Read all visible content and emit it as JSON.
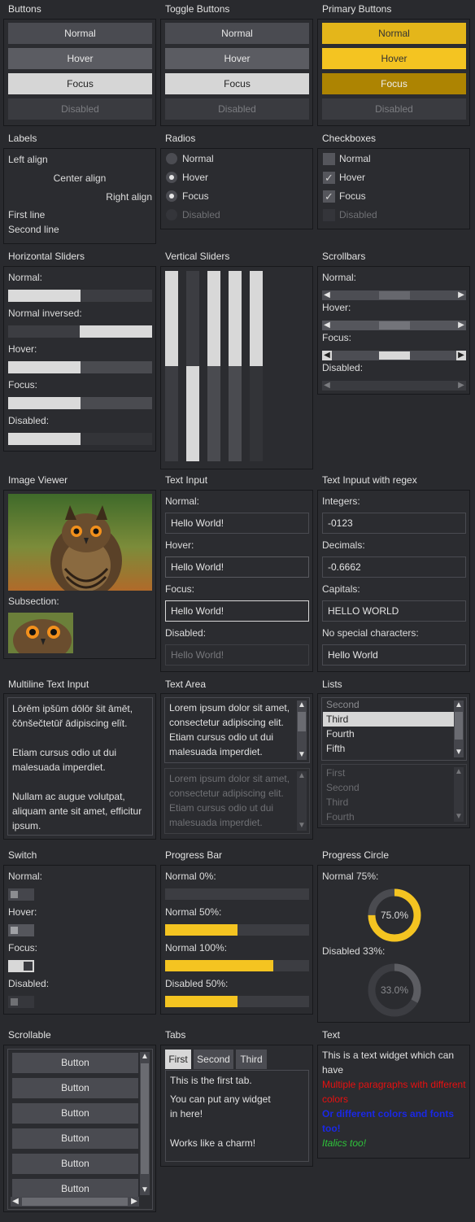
{
  "buttons": {
    "title": "Buttons",
    "normal": "Normal",
    "hover": "Hover",
    "focus": "Focus",
    "disabled": "Disabled"
  },
  "toggle_buttons": {
    "title": "Toggle Buttons",
    "normal": "Normal",
    "hover": "Hover",
    "focus": "Focus",
    "disabled": "Disabled"
  },
  "primary_buttons": {
    "title": "Primary Buttons",
    "normal": "Normal",
    "hover": "Hover",
    "focus": "Focus",
    "disabled": "Disabled"
  },
  "labels": {
    "title": "Labels",
    "left": "Left align",
    "center": "Center align",
    "right": "Right align",
    "line1": "First line",
    "line2": "Second line"
  },
  "radios": {
    "title": "Radios",
    "normal": "Normal",
    "hover": "Hover",
    "focus": "Focus",
    "disabled": "Disabled"
  },
  "checkboxes": {
    "title": "Checkboxes",
    "normal": "Normal",
    "hover": "Hover",
    "focus": "Focus",
    "disabled": "Disabled"
  },
  "hsliders": {
    "title": "Horizontal Sliders",
    "normal": "Normal:",
    "inversed": "Normal inversed:",
    "hover": "Hover:",
    "focus": "Focus:",
    "disabled": "Disabled:",
    "value": 0.5
  },
  "vsliders": {
    "title": "Vertical Sliders",
    "values": [
      0.5,
      0.5,
      0.5,
      0.5,
      0.5
    ]
  },
  "scrollbars": {
    "title": "Scrollbars",
    "normal": "Normal:",
    "hover": "Hover:",
    "focus": "Focus:",
    "disabled": "Disabled:",
    "left_arrow": "◀",
    "right_arrow": "▶"
  },
  "image_viewer": {
    "title": "Image Viewer",
    "subsection": "Subsection:"
  },
  "text_input": {
    "title": "Text Input",
    "normal": "Normal:",
    "hover": "Hover:",
    "focus": "Focus:",
    "disabled": "Disabled:",
    "value": "Hello World!"
  },
  "regex_input": {
    "title": "Text Inpuut with regex",
    "integers": "Integers:",
    "integers_value": "-0123",
    "decimals": "Decimals:",
    "decimals_value": "-0.6662",
    "capitals": "Capitals:",
    "capitals_value": "HELLO WORLD",
    "nospecial": "No special characters:",
    "nospecial_value": "Hello World"
  },
  "multiline": {
    "title": "Multiline Text Input",
    "p1a": "Lōrěm ipšūm dōlōr šit āmēt,",
    "p1b": "čōnšečtetūř ādipiscing elït.",
    "p2a": "Etiam cursus odio ut dui",
    "p2b": "malesuada imperdiet.",
    "p3a": "Nullam ac augue volutpat,",
    "p3b": "aliquam ante sit amet, efficitur",
    "p3c": "ipsum."
  },
  "text_area": {
    "title": "Text Area",
    "l1": "Lorem ipsum dolor sit amet,",
    "l2": "consectetur adipiscing elit.",
    "l3": "Etiam cursus odio ut dui",
    "l4": "malesuada imperdiet.",
    "up": "▲",
    "down": "▼"
  },
  "lists": {
    "title": "Lists",
    "list1": [
      "Second",
      "Third",
      "Fourth",
      "Fifth"
    ],
    "list2": [
      "First",
      "Second",
      "Third",
      "Fourth"
    ]
  },
  "switch": {
    "title": "Switch",
    "normal": "Normal:",
    "hover": "Hover:",
    "focus": "Focus:",
    "disabled": "Disabled:"
  },
  "progress_bar": {
    "title": "Progress Bar",
    "p0": "Normal 0%:",
    "p50": "Normal 50%:",
    "p100": "Normal 100%:",
    "dis50": "Disabled 50%:",
    "values": [
      0,
      0.5,
      0.75,
      0.5
    ]
  },
  "progress_circle": {
    "title": "Progress Circle",
    "normal": "Normal 75%:",
    "normal_value": "75.0%",
    "disabled": "Disabled 33%:",
    "disabled_value": "33.0%"
  },
  "scrollable": {
    "title": "Scrollable",
    "buttons": [
      "Button",
      "Button",
      "Button",
      "Button",
      "Button",
      "Button"
    ]
  },
  "tabs": {
    "title": "Tabs",
    "tab1": "First",
    "tab2": "Second",
    "tab3": "Third",
    "c1": "This is the first tab.",
    "c2": "You can put any widget",
    "c3": "in here!",
    "c4": "Works like a charm!"
  },
  "text": {
    "title": "Text",
    "t1": "This is a text widget which can",
    "t2": "have",
    "t3": "Multiple paragraphs with different",
    "t4": "colors",
    "t5": "Or different colors and fonts",
    "t6": "too!",
    "t7": "Italics too!"
  },
  "colors": {
    "accent": "#f4c421",
    "red": "#e81010",
    "blue": "#1a28e6",
    "green": "#2ec43a"
  }
}
